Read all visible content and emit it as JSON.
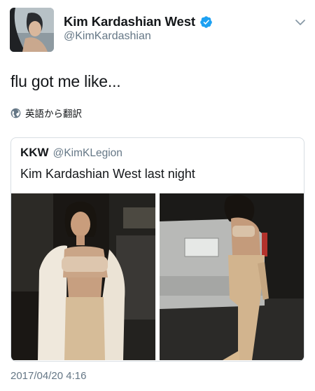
{
  "author": {
    "display_name": "Kim Kardashian West",
    "handle": "@KimKardashian",
    "verified": true,
    "avatar_icon": "profile-photo"
  },
  "tweet": {
    "text": "flu got me like...",
    "translate_label": "英語から翻訳",
    "timestamp": "2017/04/20 4:16"
  },
  "quoted_tweet": {
    "display_name": "KKW",
    "handle": "@KimKLegion",
    "text": "Kim Kardashian West last night",
    "images": [
      "photo-front-view",
      "photo-back-view"
    ]
  },
  "colors": {
    "text_primary": "#14171a",
    "text_secondary": "#657786",
    "verified_blue": "#1da1f2",
    "border": "#d8dee3"
  }
}
